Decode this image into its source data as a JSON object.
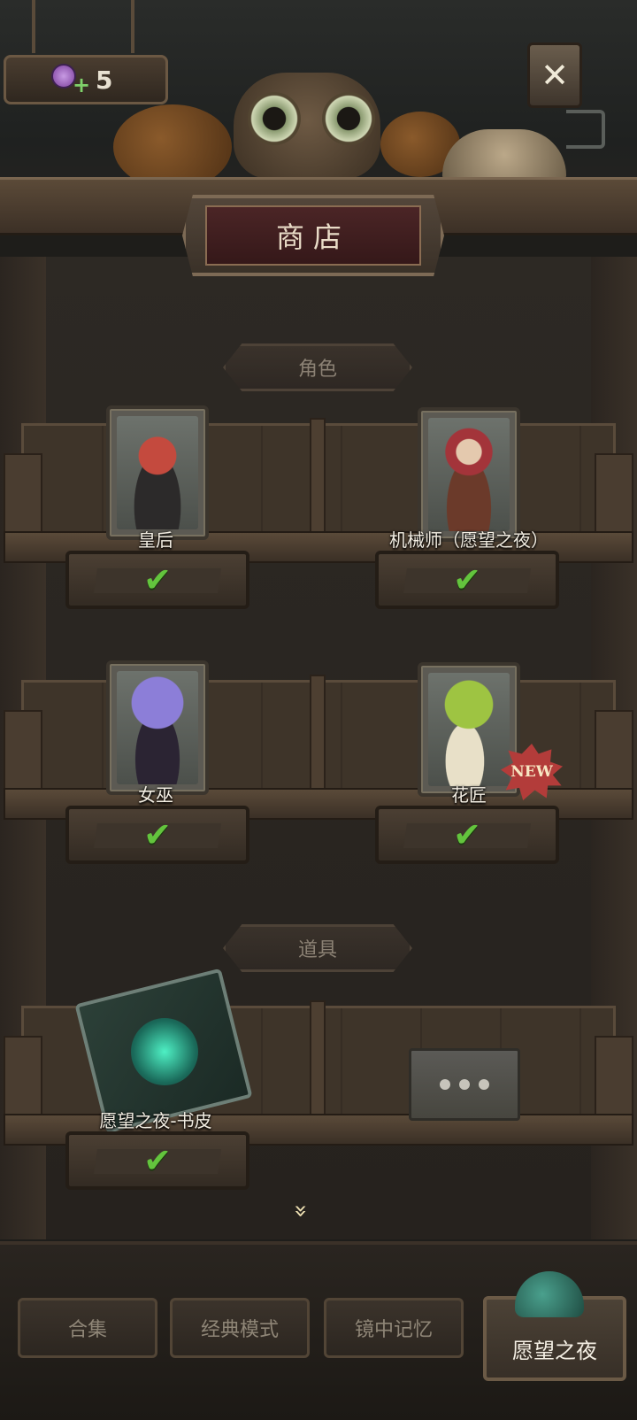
{
  "currency": {
    "icon": "candy-plus-icon",
    "value": "5"
  },
  "title": "商店",
  "sections": {
    "characters": {
      "label": "角色"
    },
    "items": {
      "label": "道具"
    }
  },
  "characters": [
    {
      "name": "皇后",
      "status": "owned",
      "portrait": "queen-portrait"
    },
    {
      "name": "机械师（愿望之夜）",
      "status": "owned",
      "portrait": "mechanic-portrait"
    },
    {
      "name": "女巫",
      "status": "owned",
      "portrait": "witch-portrait"
    },
    {
      "name": "花匠",
      "status": "owned",
      "portrait": "gardener-portrait",
      "badge": "NEW"
    }
  ],
  "items": [
    {
      "name": "愿望之夜-书皮",
      "status": "owned",
      "icon": "book-cover-icon"
    },
    {
      "name": "",
      "icon": "more-icon"
    }
  ],
  "tabs": [
    {
      "label": "合集",
      "active": false
    },
    {
      "label": "经典模式",
      "active": false
    },
    {
      "label": "镜中记忆",
      "active": false
    },
    {
      "label": "愿望之夜",
      "active": true
    }
  ],
  "colors": {
    "check": "#63c43d",
    "badge": "#b33c3a",
    "title_plate": "#4b2526"
  }
}
